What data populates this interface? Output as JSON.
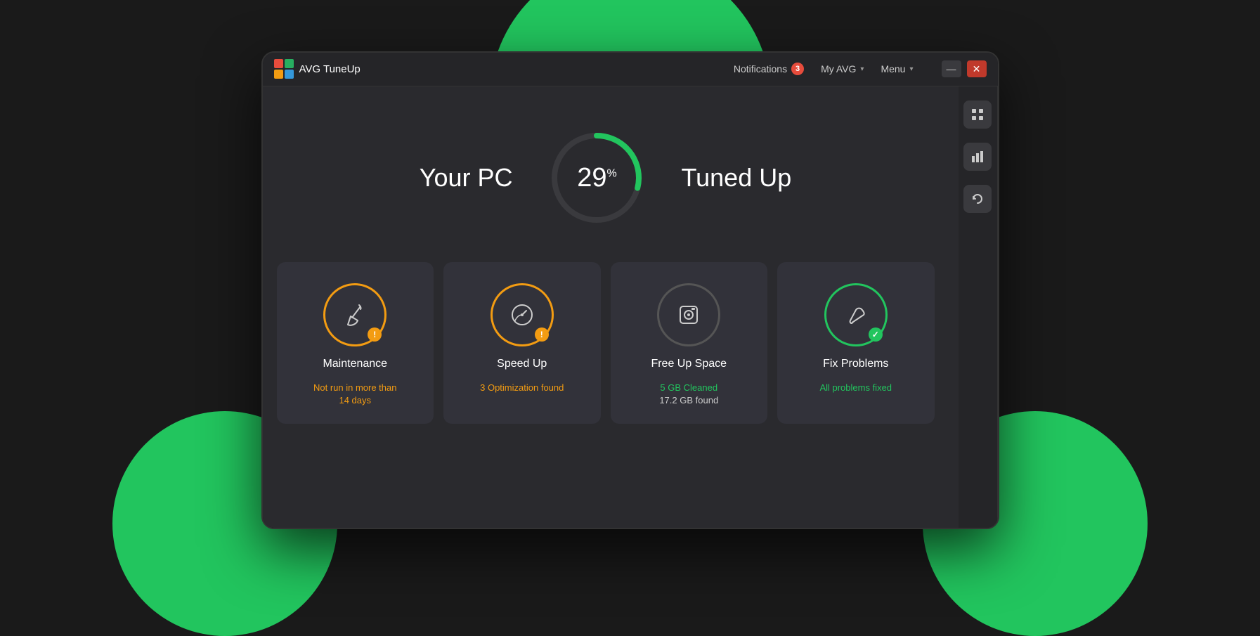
{
  "app": {
    "name": "AVG TuneUp",
    "logo_colors": [
      "#e74c3c",
      "#27ae60",
      "#f39c12",
      "#3498db"
    ]
  },
  "titlebar": {
    "notifications_label": "Notifications",
    "notifications_count": "3",
    "my_avg_label": "My AVG",
    "menu_label": "Menu",
    "minimize_label": "—",
    "close_label": "✕"
  },
  "sidebar": {
    "icons": [
      "grid-icon",
      "bar-chart-icon",
      "refresh-icon"
    ]
  },
  "hero": {
    "left_text": "Your PC",
    "right_text": "Tuned Up",
    "percent": "29",
    "percent_suffix": "%"
  },
  "cards": [
    {
      "id": "maintenance",
      "title": "Maintenance",
      "icon": "🧹",
      "ring": "orange",
      "status": "warning",
      "sub1": "Not run in more than",
      "sub2": "14 days",
      "sub_color": "orange"
    },
    {
      "id": "speed-up",
      "title": "Speed Up",
      "icon": "⚡",
      "ring": "orange",
      "status": "warning",
      "sub1": "3 Optimization found",
      "sub2": "",
      "sub_color": "orange"
    },
    {
      "id": "free-up-space",
      "title": "Free Up Space",
      "icon": "💾",
      "ring": "gray",
      "status": "none",
      "sub1": "5 GB Cleaned",
      "sub2": "17.2 GB found",
      "sub_color": "green",
      "sub2_color": "white"
    },
    {
      "id": "fix-problems",
      "title": "Fix Problems",
      "icon": "🔧",
      "ring": "green",
      "status": "success",
      "sub1": "All problems fixed",
      "sub2": "",
      "sub_color": "green"
    }
  ]
}
